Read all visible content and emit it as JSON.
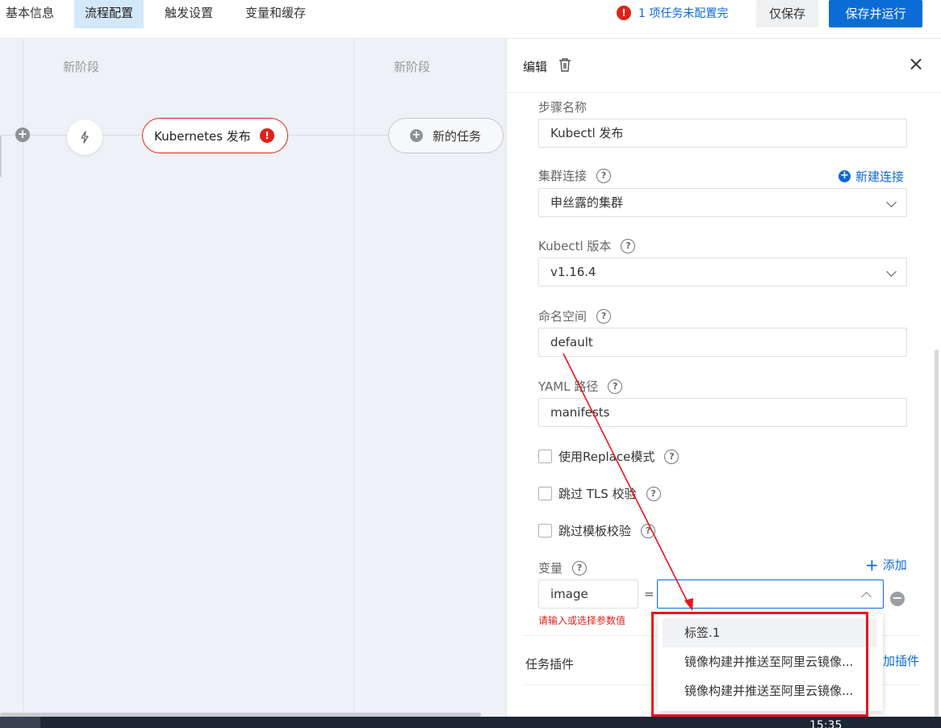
{
  "tabs": [
    {
      "label": "基本信息",
      "active": false
    },
    {
      "label": "流程配置",
      "active": true
    },
    {
      "label": "触发设置",
      "active": false
    },
    {
      "label": "变量和缓存",
      "active": false
    }
  ],
  "warning": {
    "text": "1 项任务未配置完",
    "icon": "alert-circle-icon"
  },
  "actions": {
    "save_only": "仅保存",
    "save_run": "保存并运行"
  },
  "canvas": {
    "stages": [
      "新阶段",
      "新阶段"
    ],
    "trigger_icon": "lightning-icon",
    "task_node": {
      "label": "Kubernetes 发布",
      "error_icon": "!"
    },
    "new_task": {
      "label": "新的任务",
      "icon": "+"
    }
  },
  "panel": {
    "title": "编辑",
    "step_name": {
      "label": "步骤名称",
      "value": "Kubectl 发布"
    },
    "cluster": {
      "label": "集群连接",
      "value": "申丝露的集群",
      "new_link": "新建连接"
    },
    "kubectl_version": {
      "label": "Kubectl 版本",
      "value": "v1.16.4"
    },
    "namespace": {
      "label": "命名空间",
      "value": "default"
    },
    "yaml_path": {
      "label": "YAML 路径",
      "value": "manifests"
    },
    "checkboxes": [
      {
        "label": "使用Replace模式",
        "checked": false
      },
      {
        "label": "跳过 TLS 校验",
        "checked": false
      },
      {
        "label": "跳过模板校验",
        "checked": false
      }
    ],
    "variables": {
      "label": "变量",
      "add_link": "添加",
      "name_value": "image",
      "equals": "=",
      "value": "",
      "error": "请输入或选择参数值"
    },
    "plugins": {
      "label": "任务插件",
      "add_link": "加插件"
    }
  },
  "dropdown": {
    "options": [
      "标签.1",
      "镜像构建并推送至阿里云镜像...",
      "镜像构建并推送至阿里云镜像..."
    ]
  },
  "taskbar": {
    "time": "15:35"
  },
  "colors": {
    "primary": "#0b6cd6",
    "error": "#e0221a",
    "active_tab": "#d3e9fb"
  }
}
